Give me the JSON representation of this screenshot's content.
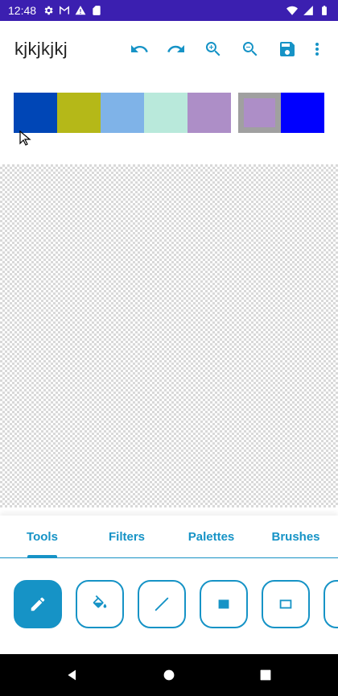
{
  "status_bar": {
    "time": "12:48",
    "left_icons": [
      "gear-icon",
      "gmail-icon",
      "warning-icon",
      "sd-card-icon"
    ],
    "right_icons": [
      "wifi-icon",
      "signal-icon",
      "battery-icon"
    ]
  },
  "app_bar": {
    "title": "kjkjkjkj",
    "actions": [
      "undo-icon",
      "redo-icon",
      "zoom-in-icon",
      "zoom-out-icon",
      "save-icon",
      "more-vert-icon"
    ]
  },
  "palette": {
    "colors": [
      "#0046b6",
      "#b5b818",
      "#7fb3e8",
      "#b9e9db",
      "#ad8ec7"
    ],
    "primary_color": "#ad8ec7",
    "secondary_color": "#0000ff"
  },
  "tabs": [
    {
      "label": "Tools",
      "active": true
    },
    {
      "label": "Filters",
      "active": false
    },
    {
      "label": "Palettes",
      "active": false
    },
    {
      "label": "Brushes",
      "active": false
    }
  ],
  "tools": [
    "pencil-icon",
    "fill-bucket-icon",
    "line-icon",
    "filled-rectangle-icon",
    "outline-rectangle-icon",
    "more-tools-icon"
  ],
  "selected_tool": "pencil-icon",
  "colors": {
    "accent": "#1693c6",
    "status_bar": "#3b1fb0"
  }
}
